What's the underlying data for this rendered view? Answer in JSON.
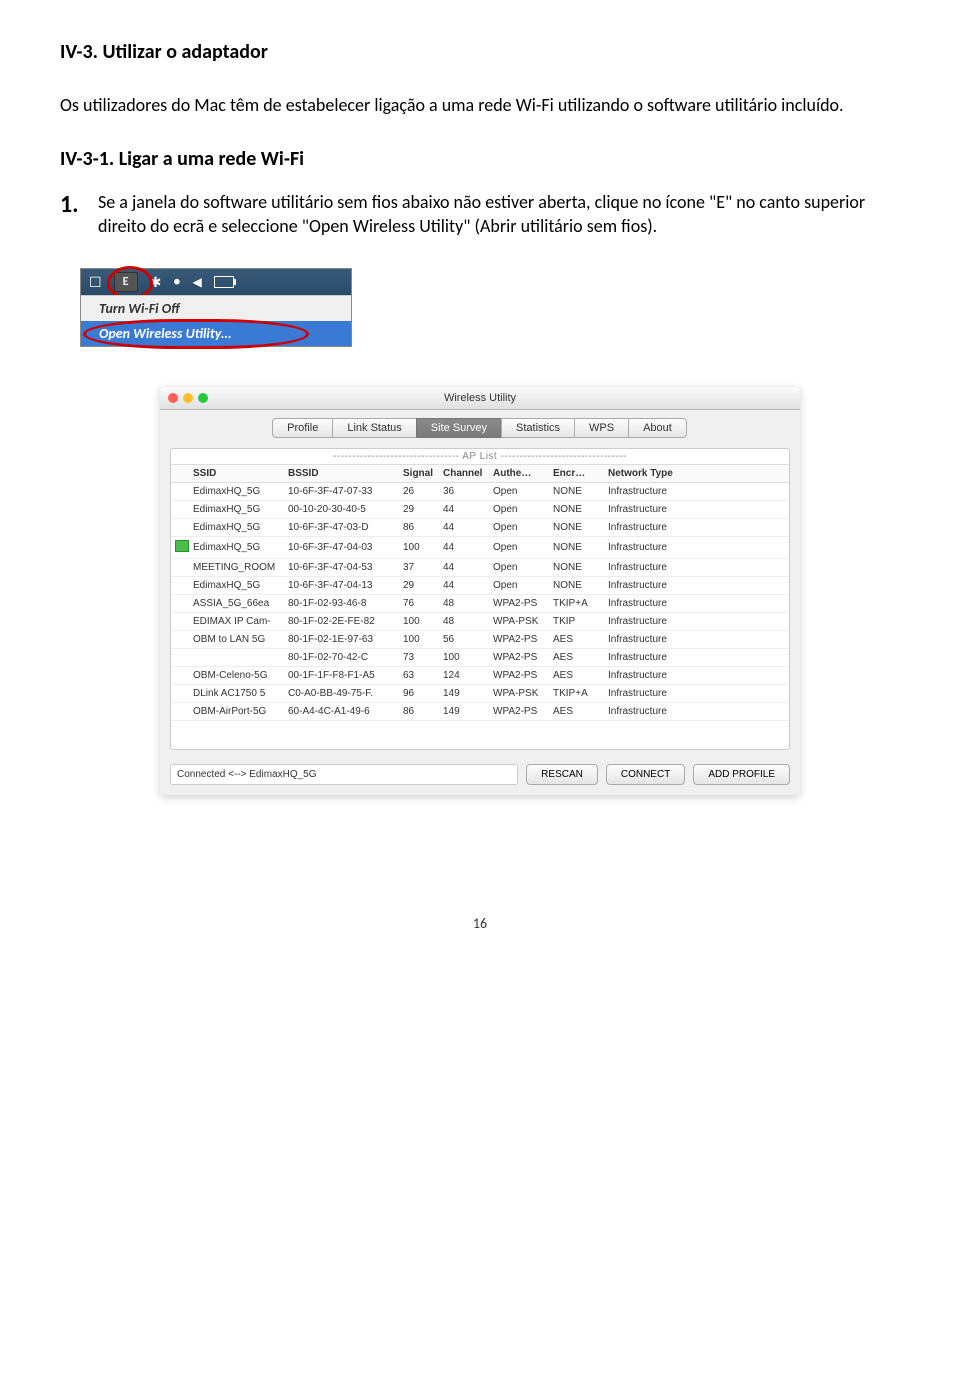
{
  "section_title": "IV-3. Utilizar o adaptador",
  "intro_para": "Os utilizadores do Mac têm de estabelecer ligação a uma rede Wi-Fi utilizando o software utilitário incluído.",
  "subsection_title": "IV-3-1. Ligar a uma rede Wi-Fi",
  "step1_num": "1.",
  "step1_text": "Se a janela do software utilitário sem fios abaixo não estiver aberta, clique no ícone \"E\" no canto superior direito do ecrã e seleccione \"Open Wireless Utility\" (Abrir utilitário sem fios).",
  "menu_item_1": "Turn Wi-Fi Off",
  "menu_item_2": "Open Wireless Utility…",
  "utility": {
    "title": "Wireless Utility",
    "tabs": [
      "Profile",
      "Link Status",
      "Site Survey",
      "Statistics",
      "WPS",
      "About"
    ],
    "aplist_label": "--------------------------------- AP List ---------------------------------",
    "headers": [
      "SSID",
      "BSSID",
      "Signal",
      "Channel",
      "Authe…",
      "Encr…",
      "Network Type"
    ],
    "rows": [
      [
        "EdimaxHQ_5G",
        "10-6F-3F-47-07-33",
        "26",
        "36",
        "Open",
        "NONE",
        "Infrastructure"
      ],
      [
        "EdimaxHQ_5G",
        "00-10-20-30-40-5",
        "29",
        "44",
        "Open",
        "NONE",
        "Infrastructure"
      ],
      [
        "EdimaxHQ_5G",
        "10-6F-3F-47-03-D",
        "86",
        "44",
        "Open",
        "NONE",
        "Infrastructure"
      ],
      [
        "EdimaxHQ_5G",
        "10-6F-3F-47-04-03",
        "100",
        "44",
        "Open",
        "NONE",
        "Infrastructure"
      ],
      [
        "MEETING_ROOM",
        "10-6F-3F-47-04-53",
        "37",
        "44",
        "Open",
        "NONE",
        "Infrastructure"
      ],
      [
        "EdimaxHQ_5G",
        "10-6F-3F-47-04-13",
        "29",
        "44",
        "Open",
        "NONE",
        "Infrastructure"
      ],
      [
        "ASSIA_5G_66ea",
        "80-1F-02-93-46-8",
        "76",
        "48",
        "WPA2-PS",
        "TKIP+A",
        "Infrastructure"
      ],
      [
        "EDIMAX IP Cam-",
        "80-1F-02-2E-FE-82",
        "100",
        "48",
        "WPA-PSK",
        "TKIP",
        "Infrastructure"
      ],
      [
        "OBM to LAN 5G",
        "80-1F-02-1E-97-63",
        "100",
        "56",
        "WPA2-PS",
        "AES",
        "Infrastructure"
      ],
      [
        "",
        "80-1F-02-70-42-C",
        "73",
        "100",
        "WPA2-PS",
        "AES",
        "Infrastructure"
      ],
      [
        "OBM-Celeno-5G",
        "00-1F-1F-F8-F1-A5",
        "63",
        "124",
        "WPA2-PS",
        "AES",
        "Infrastructure"
      ],
      [
        "DLink AC1750 5",
        "C0-A0-BB-49-75-F.",
        "96",
        "149",
        "WPA-PSK",
        "TKIP+A",
        "Infrastructure"
      ],
      [
        "OBM-AirPort-5G",
        "60-A4-4C-A1-49-6",
        "86",
        "149",
        "WPA2-PS",
        "AES",
        "Infrastructure"
      ]
    ],
    "selected_row": 3,
    "status": "Connected <--> EdimaxHQ_5G",
    "buttons": [
      "RESCAN",
      "CONNECT",
      "ADD PROFILE"
    ]
  },
  "page_number": "16"
}
